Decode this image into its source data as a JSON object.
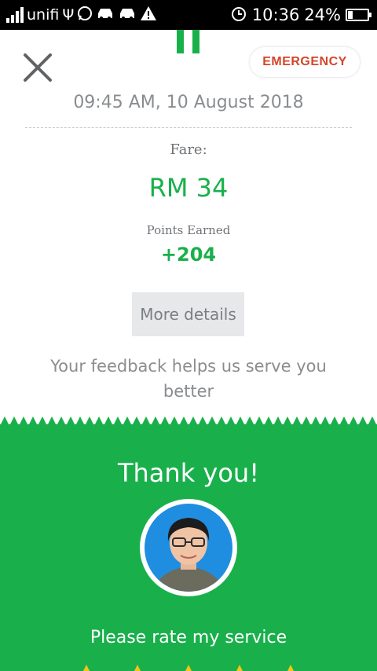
{
  "status_bar": {
    "carrier": "unifi",
    "time": "10:36",
    "battery": "24%",
    "battery_level": 0.24
  },
  "header": {
    "emergency_label": "EMERGENCY"
  },
  "trip": {
    "datetime": "09:45 AM, 10 August 2018",
    "fare_label": "Fare:",
    "fare_value": "RM 34",
    "points_label": "Points Earned",
    "points_value": "+204"
  },
  "actions": {
    "more_details_label": "More details"
  },
  "feedback": {
    "text": "Your feedback helps us serve you better"
  },
  "rating": {
    "thanks": "Thank you!",
    "prompt": "Please rate my service",
    "star_count": 5
  },
  "colors": {
    "brand_green": "#19b04b",
    "emergency_red": "#d2462a",
    "star_yellow": "#f5c518"
  }
}
